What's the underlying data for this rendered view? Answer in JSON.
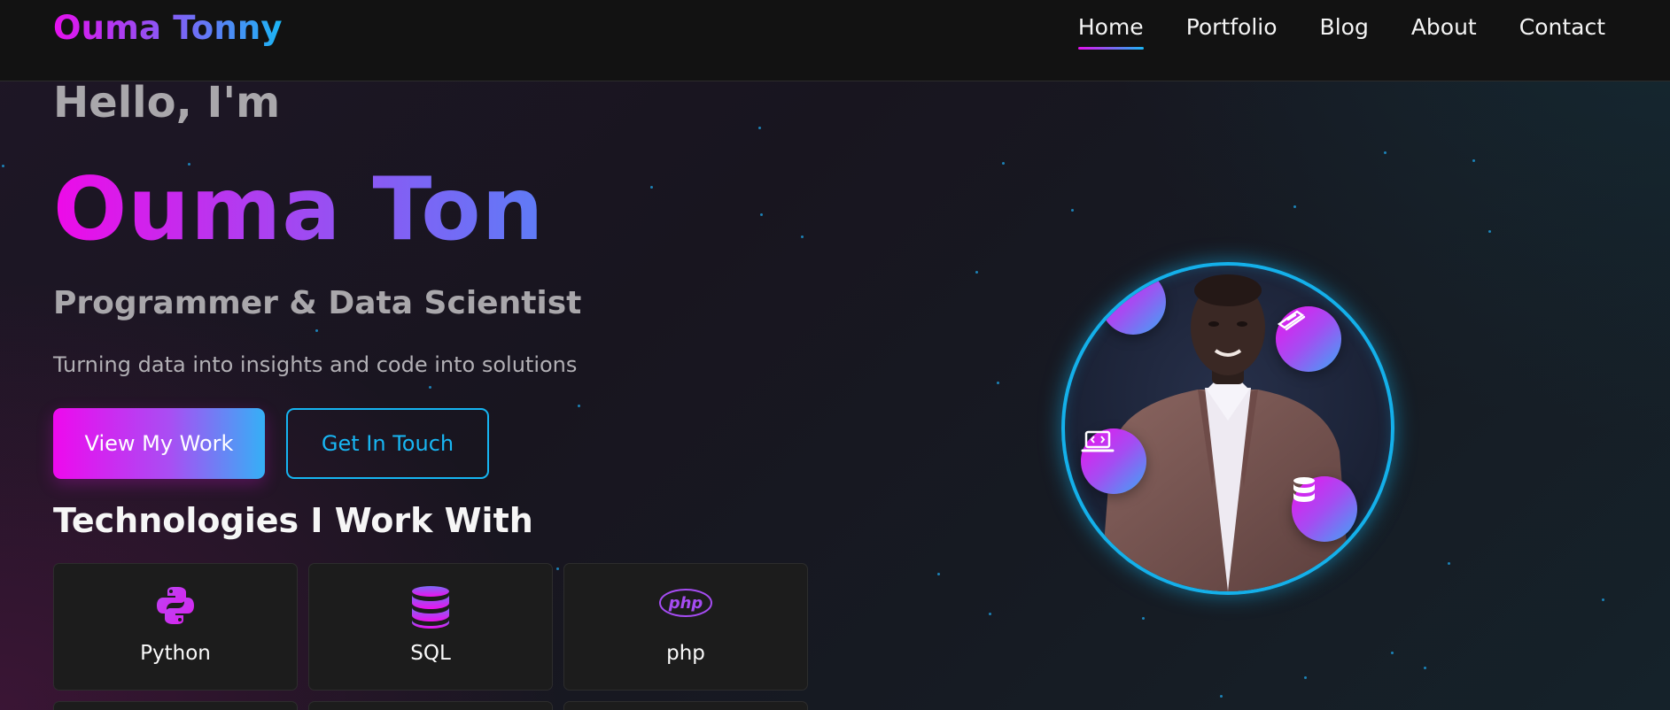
{
  "navbar": {
    "logo": "Ouma Tonny",
    "links": [
      {
        "label": "Home",
        "active": true
      },
      {
        "label": "Portfolio",
        "active": false
      },
      {
        "label": "Blog",
        "active": false
      },
      {
        "label": "About",
        "active": false
      },
      {
        "label": "Contact",
        "active": false
      }
    ]
  },
  "hero": {
    "greeting": "Hello, I'm",
    "name": "Ouma Ton",
    "role": "Programmer & Data Scientist",
    "tagline": "Turning data into insights and code into solutions",
    "primary_button": "View My Work",
    "secondary_button": "Get In Touch"
  },
  "technologies": {
    "title": "Technologies I Work With",
    "items": [
      {
        "label": "Python",
        "icon": "python-icon"
      },
      {
        "label": "SQL",
        "icon": "database-icon"
      },
      {
        "label": "php",
        "icon": "php-icon",
        "icon_text": "php"
      }
    ]
  },
  "profile": {
    "orbit_icons": [
      "code-icon",
      "layers-icon",
      "laptop-code-icon",
      "database-icon"
    ]
  },
  "colors": {
    "accent_magenta": "#ee0ae8",
    "accent_blue": "#16b5f2",
    "navbar_bg": "#121212",
    "card_bg": "#1c1c1c"
  }
}
